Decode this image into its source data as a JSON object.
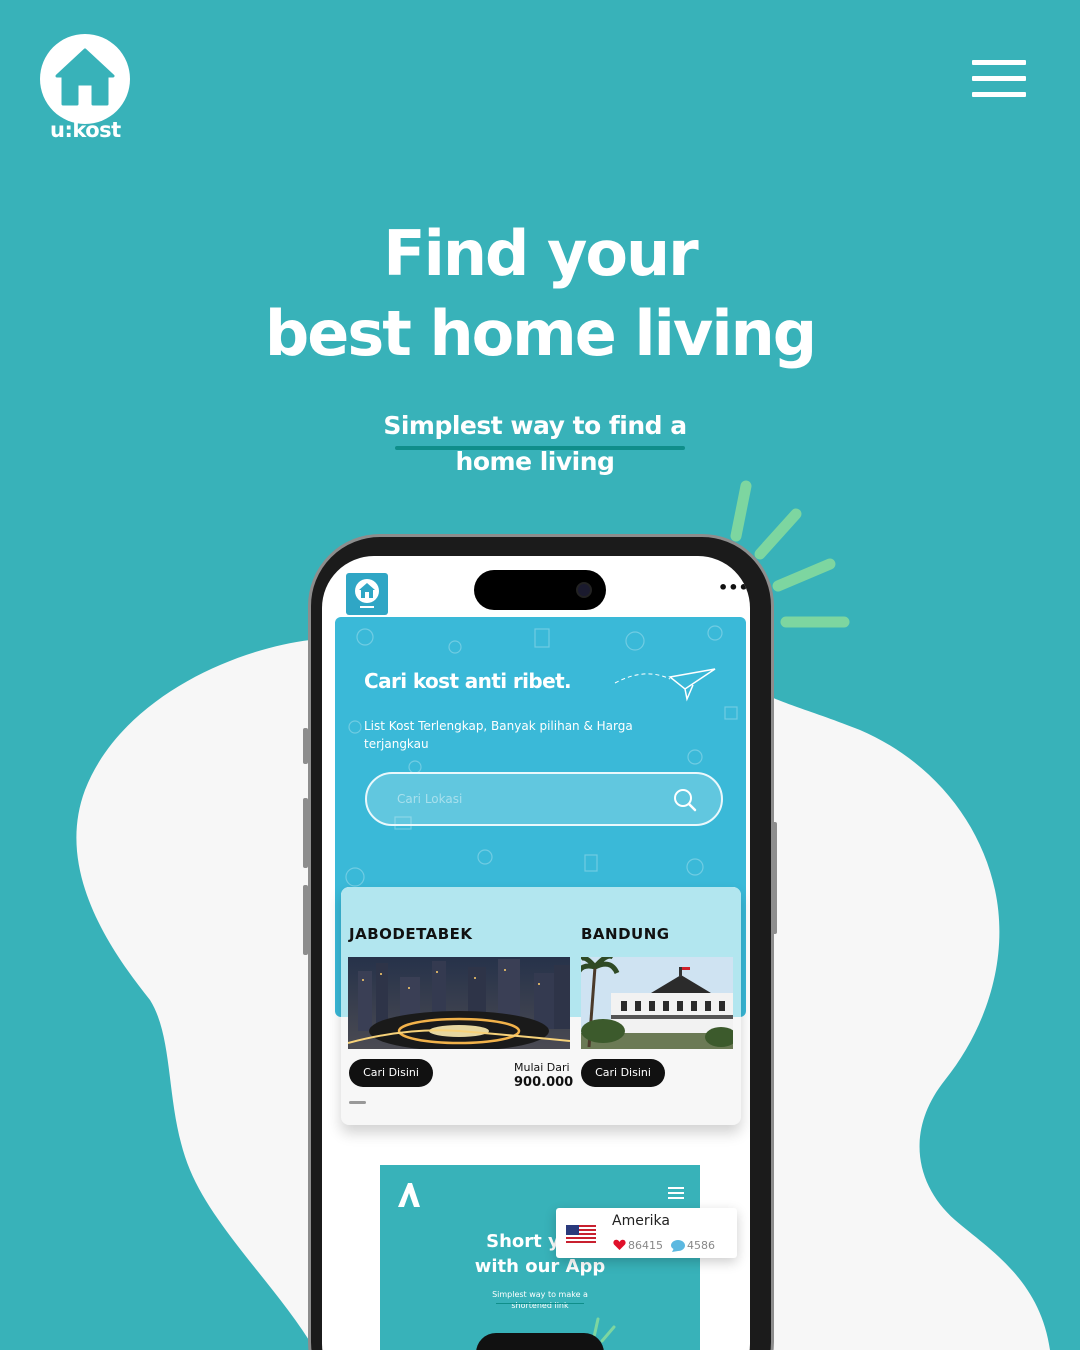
{
  "brand": {
    "name": "u:kost"
  },
  "hero": {
    "headline_line1": "Find your",
    "headline_line2": "best home living",
    "sub_line1": "Simplest way to find a",
    "sub_line2": "home living"
  },
  "app": {
    "hero_title": "Cari kost anti ribet.",
    "hero_sub": "List Kost Terlengkap, Banyak pilihan & Harga terjangkau",
    "search_placeholder": "Cari Lokasi",
    "menu_dots": "•••",
    "cities": [
      {
        "name": "JABODETABEK",
        "button": "Cari Disini",
        "price_label": "Mulai Dari",
        "price": "900.000"
      },
      {
        "name": "BANDUNG",
        "button": "Cari Disini"
      }
    ]
  },
  "mini_app": {
    "title_line1": "Short your",
    "title_line2": "with our App",
    "sub_line1": "Simplest way to make a",
    "sub_line2": "shortened link"
  },
  "stats_card": {
    "country": "Amerika",
    "likes": "86415",
    "comments": "4586"
  },
  "colors": {
    "background": "#38b2b9",
    "blob": "#f7f7f7",
    "accent_green": "#7dd6a0",
    "app_blue": "#3ab9d8"
  }
}
